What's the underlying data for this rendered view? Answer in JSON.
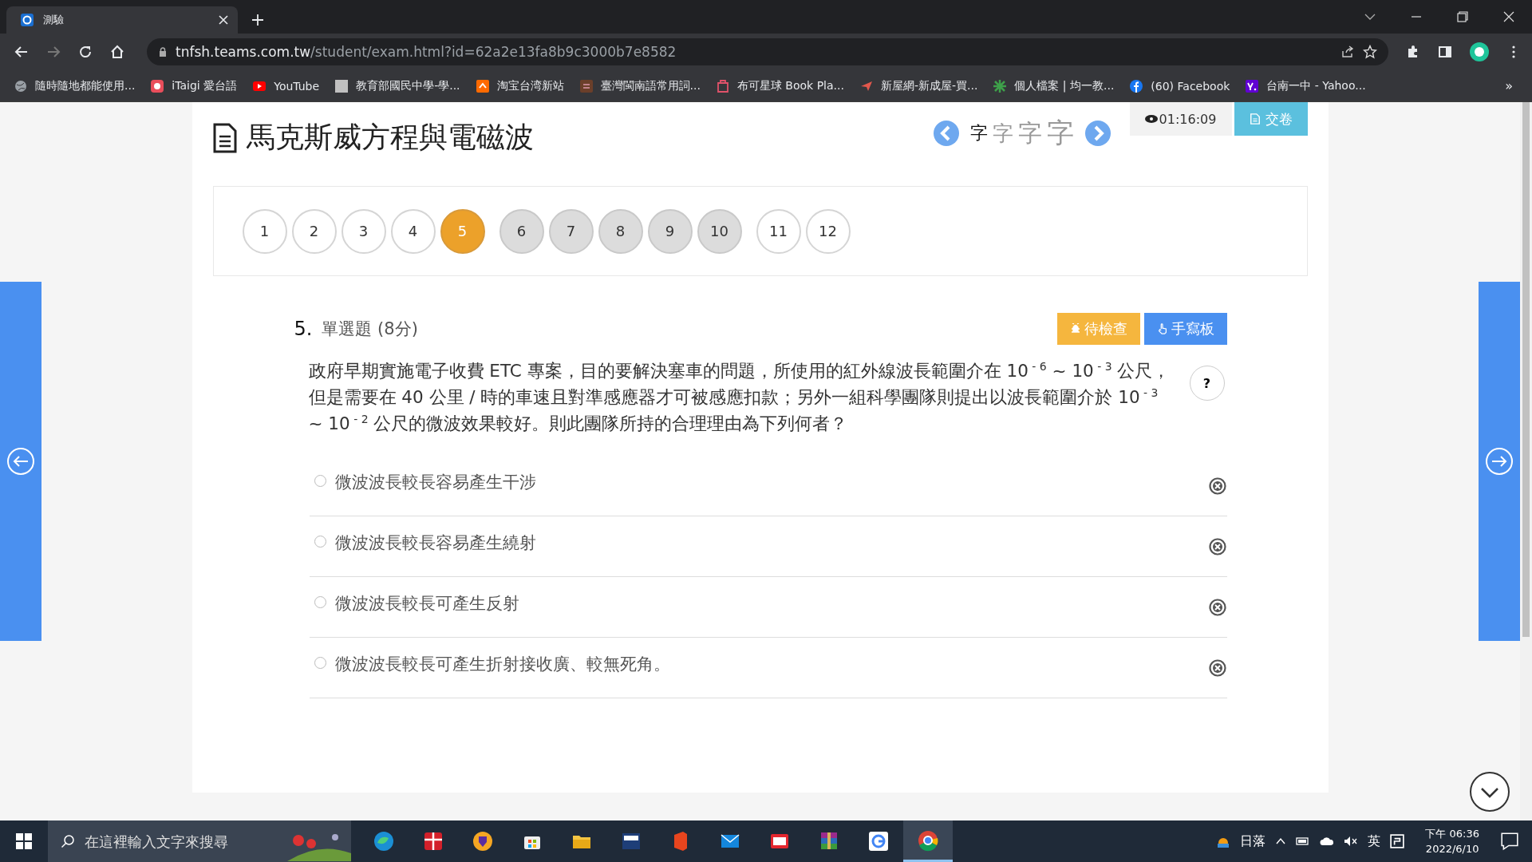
{
  "browser": {
    "tab": {
      "title": "測驗",
      "selected": true
    },
    "address": {
      "domain": "tnfsh.teams.com.tw",
      "path": "/student/exam.html?id=62a2e13fa8b9c3000b7e8582"
    },
    "bookmarks": [
      {
        "kind": "globe",
        "label": "隨時隨地都能使用..."
      },
      {
        "kind": "redcircle",
        "label": "iTaigi 愛台語"
      },
      {
        "kind": "play",
        "label": "YouTube"
      },
      {
        "kind": "greysquare",
        "label": "教育部國民中學-學..."
      },
      {
        "kind": "orangesquare",
        "label": "淘宝台湾新站"
      },
      {
        "kind": "brownsquare",
        "label": "臺灣閩南語常用詞..."
      },
      {
        "kind": "pinksquare",
        "label": "布可星球 Book Pla..."
      },
      {
        "kind": "plane",
        "label": "新屋網-新成屋-買..."
      },
      {
        "kind": "star",
        "label": "個人檔案 | 均一教..."
      },
      {
        "kind": "facebook",
        "label": "(60) Facebook"
      },
      {
        "kind": "yahoo",
        "label": "台南一中 - Yahoo..."
      }
    ],
    "more": "»"
  },
  "exam": {
    "title": "馬克斯威方程與電磁波",
    "font_sizes": [
      {
        "label": "字",
        "selected": true
      },
      {
        "label": "字",
        "selected": false
      },
      {
        "label": "字",
        "selected": false
      },
      {
        "label": "字",
        "selected": false
      }
    ],
    "timer": "01:16:09",
    "submit": "交卷",
    "question_groups": [
      [
        {
          "label": "1",
          "selected": false,
          "shaded": false
        },
        {
          "label": "2",
          "selected": false,
          "shaded": false
        },
        {
          "label": "3",
          "selected": false,
          "shaded": false
        },
        {
          "label": "4",
          "selected": false,
          "shaded": false
        },
        {
          "label": "5",
          "selected": true,
          "shaded": false
        }
      ],
      [
        {
          "label": "6",
          "selected": false,
          "shaded": true
        },
        {
          "label": "7",
          "selected": false,
          "shaded": true
        },
        {
          "label": "8",
          "selected": false,
          "shaded": true
        },
        {
          "label": "9",
          "selected": false,
          "shaded": true
        },
        {
          "label": "10",
          "selected": false,
          "shaded": true
        }
      ],
      [
        {
          "label": "11",
          "selected": false,
          "shaded": false
        },
        {
          "label": "12",
          "selected": false,
          "shaded": false
        }
      ]
    ],
    "question": {
      "number": "5.",
      "type": "單選題 (8分)",
      "review_button": "待檢查",
      "handwriting_button": "手寫板",
      "help": "?",
      "text": "政府早期實施電子收費 ETC 專案，目的要解決塞車的問題，所使用的紅外線波長範圍介在 10$^{ - 6}$ ~ 10$^{ - 3}$ 公尺，但是需要在 40 公里 / 時的車速且對準感應器才可被感應扣款；另外一組科學團隊則提出以波長範圍介於 10$^{ - 3}$ ~ 10$^{ - 2}$ 公尺的微波效果較好。則此團隊所持的合理理由為下列何者？",
      "options": [
        {
          "label": "微波波長較長容易產生干涉",
          "selected": false
        },
        {
          "label": "微波波長較長容易產生繞射",
          "selected": false
        },
        {
          "label": "微波波長較長可產生反射",
          "selected": false
        },
        {
          "label": "微波波長較長可產生折射接收廣、較無死角。",
          "selected": false
        }
      ]
    }
  },
  "taskbar": {
    "search_placeholder": "在這裡輸入文字來搜尋",
    "apps": [
      {
        "kind": "edge",
        "selected": false
      },
      {
        "kind": "gift",
        "selected": false
      },
      {
        "kind": "shield",
        "selected": false
      },
      {
        "kind": "store",
        "selected": false
      },
      {
        "kind": "folder",
        "selected": false
      },
      {
        "kind": "dev",
        "selected": false
      },
      {
        "kind": "office",
        "selected": false
      },
      {
        "kind": "mail",
        "selected": false
      },
      {
        "kind": "slides",
        "selected": false
      },
      {
        "kind": "archive",
        "selected": false
      },
      {
        "kind": "google",
        "selected": false
      },
      {
        "kind": "chrome",
        "selected": true
      }
    ],
    "weather": "日落",
    "ime": "英",
    "time": "下午 06:36",
    "date": "2022/6/10"
  }
}
